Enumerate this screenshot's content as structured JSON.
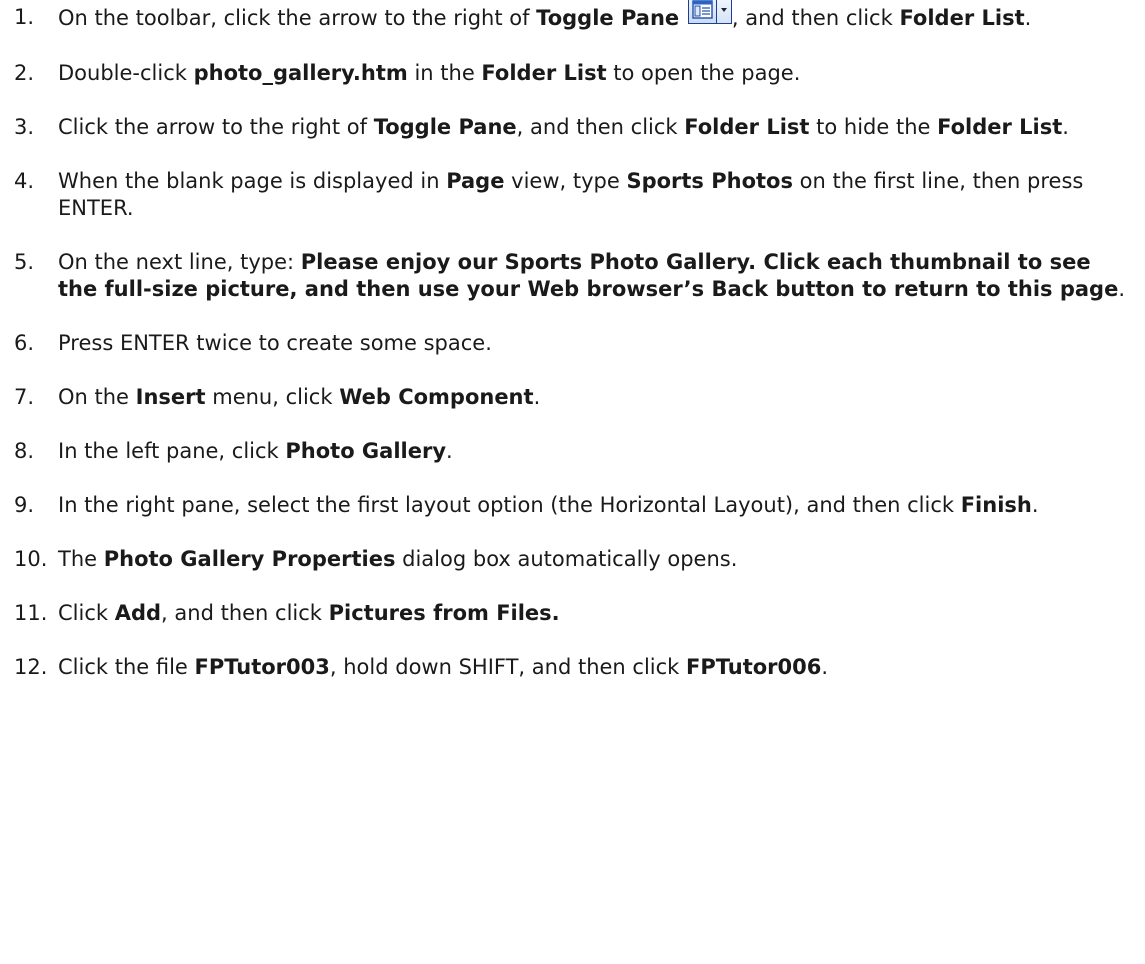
{
  "steps": [
    {
      "num": "1.",
      "parts": [
        {
          "t": "On the toolbar, click the arrow to the right of "
        },
        {
          "t": "Toggle Pane",
          "b": true
        },
        {
          "t": " "
        },
        {
          "icon": "toggle-pane-icon"
        },
        {
          "t": ", and then click "
        },
        {
          "t": "Folder List",
          "b": true
        },
        {
          "t": "."
        }
      ]
    },
    {
      "num": "2.",
      "parts": [
        {
          "t": "Double-click "
        },
        {
          "t": "photo_gallery.htm",
          "b": true
        },
        {
          "t": " in the "
        },
        {
          "t": "Folder List",
          "b": true
        },
        {
          "t": " to open the page."
        }
      ]
    },
    {
      "num": "3.",
      "parts": [
        {
          "t": "Click the arrow to the right of "
        },
        {
          "t": "Toggle Pane",
          "b": true
        },
        {
          "t": ", and then click "
        },
        {
          "t": "Folder List",
          "b": true
        },
        {
          "t": " to hide the "
        },
        {
          "t": "Folder List",
          "b": true
        },
        {
          "t": "."
        }
      ]
    },
    {
      "num": "4.",
      "parts": [
        {
          "t": "When the blank page is displayed in "
        },
        {
          "t": "Page",
          "b": true
        },
        {
          "t": " view, type "
        },
        {
          "t": "Sports Photos",
          "b": true
        },
        {
          "t": " on the first line, then press ENTER."
        }
      ]
    },
    {
      "num": "5.",
      "parts": [
        {
          "t": "On the next line, type: "
        },
        {
          "t": "Please enjoy our Sports Photo Gallery. Click each thumbnail to see the full-size picture, and then use your Web browser’s Back button to return to this page",
          "b": true
        },
        {
          "t": "."
        }
      ]
    },
    {
      "num": "6.",
      "parts": [
        {
          "t": "Press ENTER twice to create some space."
        }
      ]
    },
    {
      "num": "7.",
      "parts": [
        {
          "t": "On the "
        },
        {
          "t": "Insert",
          "b": true
        },
        {
          "t": " menu, click "
        },
        {
          "t": "Web Component",
          "b": true
        },
        {
          "t": "."
        }
      ]
    },
    {
      "num": "8.",
      "parts": [
        {
          "t": "In the left pane, click "
        },
        {
          "t": "Photo Gallery",
          "b": true
        },
        {
          "t": "."
        }
      ]
    },
    {
      "num": "9.",
      "parts": [
        {
          "t": "In the right pane, select the first layout option (the Horizontal Layout), and then click "
        },
        {
          "t": "Finish",
          "b": true
        },
        {
          "t": "."
        }
      ]
    },
    {
      "num": "10.",
      "parts": [
        {
          "t": "The "
        },
        {
          "t": "Photo Gallery Properties",
          "b": true
        },
        {
          "t": " dialog box automatically opens."
        }
      ]
    },
    {
      "num": "11.",
      "parts": [
        {
          "t": "Click "
        },
        {
          "t": "Add",
          "b": true
        },
        {
          "t": ", and then click "
        },
        {
          "t": "Pictures from Files.",
          "b": true
        }
      ]
    },
    {
      "num": "12.",
      "parts": [
        {
          "t": "Click the file "
        },
        {
          "t": "FPTutor003",
          "b": true
        },
        {
          "t": ", hold down SHIFT, and then click "
        },
        {
          "t": "FPTutor006",
          "b": true
        },
        {
          "t": "."
        }
      ]
    }
  ]
}
